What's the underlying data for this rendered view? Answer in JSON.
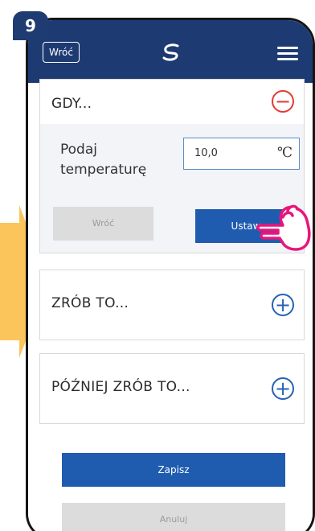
{
  "step_badge": {
    "number": "9"
  },
  "header": {
    "back_label": "Wróć",
    "logo_icon": "salus-logo-icon",
    "menu_icon": "hamburger-menu-icon"
  },
  "gdy_section": {
    "title": "GDY...",
    "collapse_icon": "minus-circle-icon",
    "temperature_label": "Podaj temperaturę",
    "temperature_value": "10,0",
    "temperature_unit": "℃",
    "back_button_label": "Wróć",
    "set_button_label": "Ustaw"
  },
  "zrob_section": {
    "title": "ZRÓB TO...",
    "expand_icon": "plus-circle-icon"
  },
  "pozniej_section": {
    "title": "PÓŹNIEJ ZRÓB TO...",
    "expand_icon": "plus-circle-icon"
  },
  "actions": {
    "save_label": "Zapisz",
    "cancel_label": "Anuluj"
  },
  "colors": {
    "topbar": "#1e3a72",
    "primary_button": "#1f5cb0",
    "disabled_button": "#dcdcdc",
    "minus_accent": "#e53a2f",
    "plus_accent": "#2463b5",
    "arrow_yellow": "#fbc55b",
    "hand_pink": "#e8157c"
  }
}
